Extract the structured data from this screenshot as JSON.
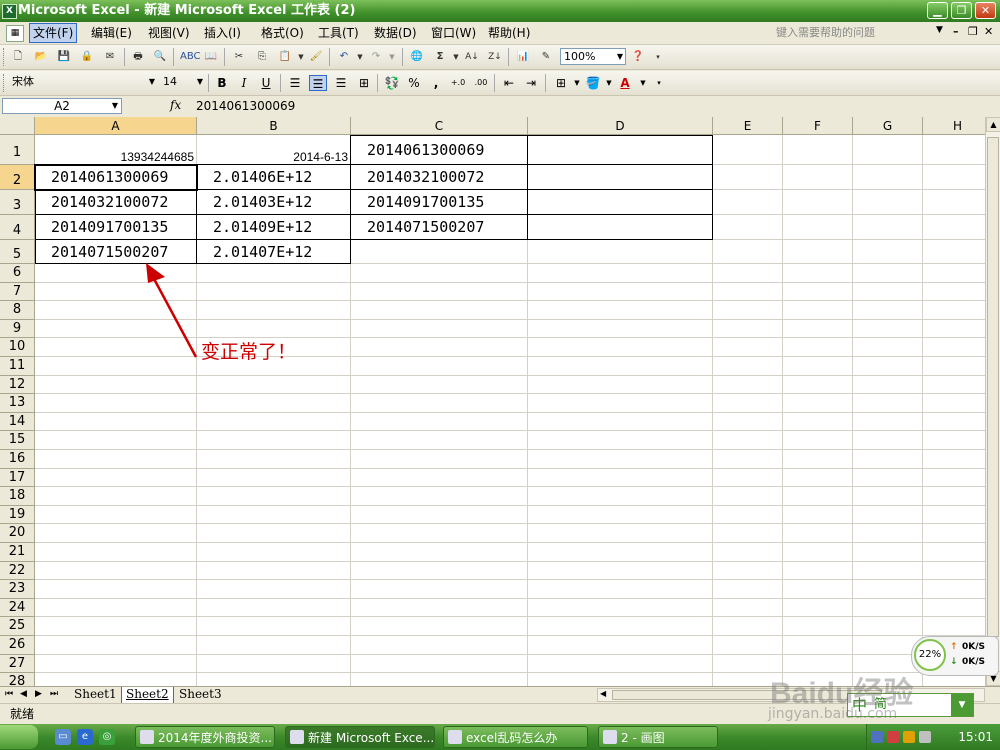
{
  "window": {
    "title": "Microsoft Excel - 新建 Microsoft Excel 工作表 (2)",
    "app_icon": "excel-icon",
    "controls": [
      "minimize",
      "restore",
      "close"
    ]
  },
  "menu": {
    "items": [
      "文件(F)",
      "编辑(E)",
      "视图(V)",
      "插入(I)",
      "格式(O)",
      "工具(T)",
      "数据(D)",
      "窗口(W)",
      "帮助(H)"
    ],
    "active_index": 0,
    "ask_placeholder": "键入需要帮助的问题"
  },
  "standard_toolbar": {
    "zoom": "100%"
  },
  "format_toolbar": {
    "font_name": "宋体",
    "font_size": "14",
    "bold": "B",
    "italic": "I",
    "underline": "U",
    "percent": "%",
    "comma": ",",
    "inc_decimal": "+.0",
    "dec_decimal": ".00"
  },
  "formula_bar": {
    "name_box": "A2",
    "fx": "fx",
    "value": "2014061300069"
  },
  "grid": {
    "columns": [
      "A",
      "B",
      "C",
      "D",
      "E",
      "F",
      "G",
      "H"
    ],
    "selected_column": "A",
    "rows": [
      "1",
      "2",
      "3",
      "4",
      "5",
      "6",
      "7",
      "8",
      "9",
      "10",
      "11",
      "12",
      "13",
      "14",
      "15",
      "16",
      "17",
      "18",
      "19",
      "20",
      "21",
      "22",
      "23",
      "24",
      "25",
      "26",
      "27",
      "28"
    ],
    "selected_row": "2",
    "cells": {
      "A1": "13934244685",
      "B1": "2014-6-13",
      "C1": "2014061300069",
      "A2": "2014061300069",
      "B2": "2.01406E+12",
      "C2": "2014032100072",
      "A3": "2014032100072",
      "B3": "2.01403E+12",
      "C3": "2014091700135",
      "A4": "2014091700135",
      "B4": "2.01409E+12",
      "C4": "2014071500207",
      "A5": "2014071500207",
      "B5": "2.01407E+12"
    },
    "active_cell": "A2"
  },
  "annotation": {
    "text": "变正常了！",
    "color": "#cc0000"
  },
  "sheets": {
    "tabs": [
      "Sheet1",
      "Sheet2",
      "Sheet3"
    ],
    "active_index": 1
  },
  "status": {
    "text": "就绪"
  },
  "taskbar": {
    "tasks": [
      {
        "label": "2014年度外商投资..."
      },
      {
        "label": "新建 Microsoft Exce..."
      },
      {
        "label": "excel乱码怎么办"
      },
      {
        "label": "2 - 画图"
      }
    ],
    "active_index": 1,
    "clock": "15:01"
  },
  "net_widget": {
    "percent": "22%",
    "up": "0K/S",
    "down": "0K/S"
  },
  "ime": {
    "lang": "中",
    "mode": "简"
  },
  "watermark": {
    "brand": "Baidu经验",
    "url": "jingyan.baidu.com"
  }
}
